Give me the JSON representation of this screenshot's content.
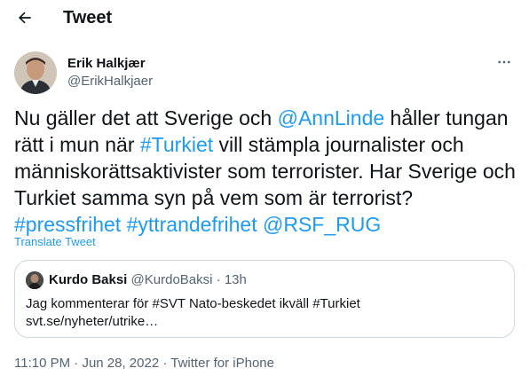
{
  "header": {
    "title": "Tweet"
  },
  "author": {
    "display_name": "Erik Halkjær",
    "handle": "@ErikHalkjaer"
  },
  "tweet": {
    "segments": [
      {
        "text": "Nu gäller det att Sverige och ",
        "link": false
      },
      {
        "text": "@AnnLinde",
        "link": true
      },
      {
        "text": " håller tungan rätt i mun när ",
        "link": false
      },
      {
        "text": "#Turkiet",
        "link": true
      },
      {
        "text": " vill stämpla journalister och människorättsaktivister som terrorister. Har Sverige och Turkiet samma syn på vem som är terrorist? ",
        "link": false
      },
      {
        "text": "#pressfrihet",
        "link": true
      },
      {
        "text": " ",
        "link": false
      },
      {
        "text": "#yttrandefrihet",
        "link": true
      },
      {
        "text": " ",
        "link": false
      },
      {
        "text": "@RSF_RUG",
        "link": true
      }
    ],
    "translate_label": "Translate Tweet"
  },
  "quote": {
    "display_name": "Kurdo Baksi",
    "handle": "@KurdoBaksi",
    "separator": "·",
    "time": "13h",
    "text_line1": "Jag kommenterar för #SVT Nato-beskedet ikväll #Turkiet",
    "text_line2": "svt.se/nyheter/utrike…"
  },
  "meta": {
    "time": "11:10 PM",
    "separator1": "·",
    "date": "Jun 28, 2022",
    "separator2": "·",
    "source": "Twitter for iPhone"
  },
  "colors": {
    "link": "#1d9bf0",
    "secondary_text": "#536471",
    "border": "#cfd9de"
  },
  "icons": {
    "back": "back-arrow-icon",
    "more": "more-options-icon"
  }
}
